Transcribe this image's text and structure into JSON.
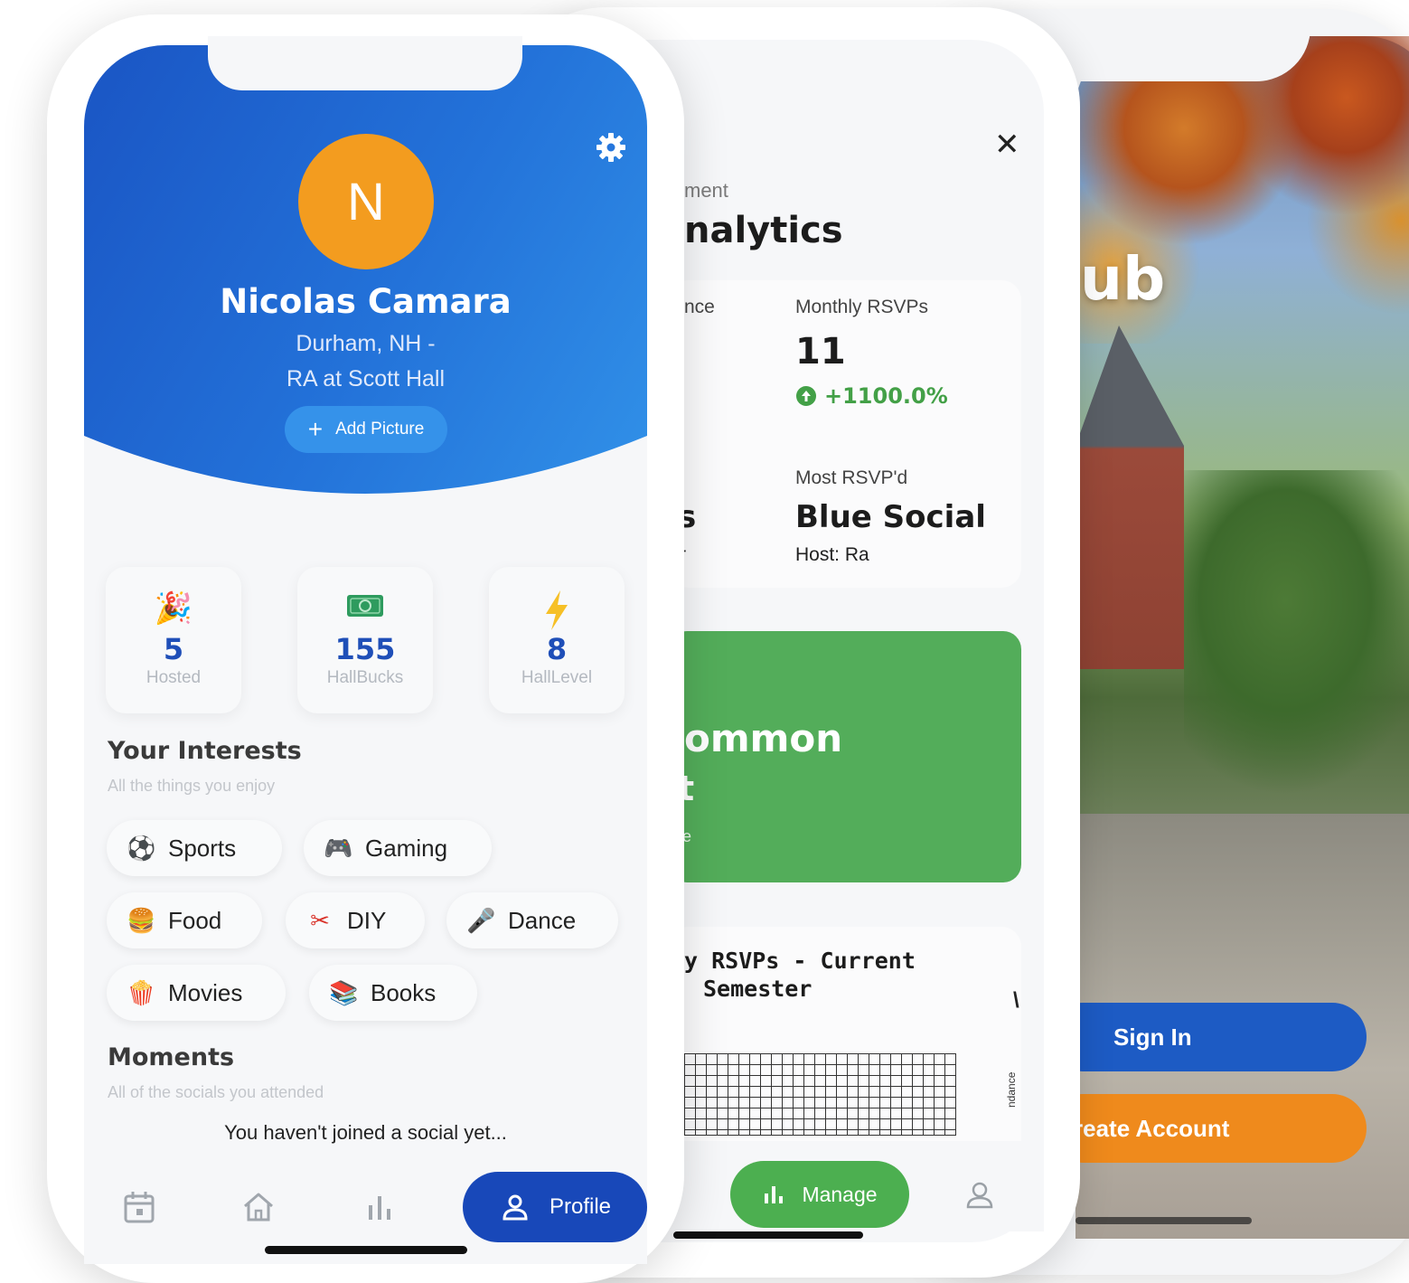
{
  "welcome_screen": {
    "heading_fragment": "ub",
    "sign_in_label": "Sign In",
    "create_account_label": "reate Account"
  },
  "manage_screen": {
    "subtitle_fragment": "ment",
    "title_fragment": "nalytics",
    "left_metric_label_fragment": "nce",
    "monthly_rsvps_label": "Monthly RSVPs",
    "monthly_rsvps_value": "11",
    "monthly_rsvps_change": "+1100.0%",
    "left_value_fragment": "s",
    "left_caption_fragment": "r",
    "most_rsvpd_label": "Most RSVP'd",
    "most_rsvpd_value": "Blue Social",
    "most_rsvpd_host": "Host: Ra",
    "green_card_title_fragment": "ommon",
    "green_card_line2_fragment": "t",
    "green_card_caption_fragment": "e",
    "chart_title_line1": "y RSVPs - Current",
    "chart_title_line2": "Semester",
    "chart_right_axis_fragment": "ndance",
    "chart_right_letter": "\\",
    "nav_manage_label": "Manage",
    "accent_green": "#4caf50"
  },
  "profile_screen": {
    "avatar_initial": "N",
    "name": "Nicolas Camara",
    "location_line1": "Durham, NH -",
    "location_line2": "RA at Scott Hall",
    "add_picture_label": "Add Picture",
    "stats": [
      {
        "icon": "party-calendar-icon",
        "value": "5",
        "caption": "Hosted"
      },
      {
        "icon": "money-bill-icon",
        "value": "155",
        "caption": "HallBucks"
      },
      {
        "icon": "lightning-icon",
        "value": "8",
        "caption": "HallLevel"
      }
    ],
    "interests_title": "Your Interests",
    "interests_subtitle": "All the things you enjoy",
    "interests": [
      {
        "emoji": "⚽",
        "label": "Sports"
      },
      {
        "emoji": "🎮",
        "label": "Gaming"
      },
      {
        "emoji": "🍔",
        "label": "Food"
      },
      {
        "emoji": "✂",
        "label": "DIY"
      },
      {
        "emoji": "🎤",
        "label": "Dance"
      },
      {
        "emoji": "🍿",
        "label": "Movies"
      },
      {
        "emoji": "📚",
        "label": "Books"
      }
    ],
    "moments_title": "Moments",
    "moments_subtitle": "All of the socials you attended",
    "moments_empty": "You haven't joined a social yet...",
    "nav_profile_label": "Profile",
    "accent_blue": "#1848b9",
    "avatar_color": "#f39c1f"
  }
}
